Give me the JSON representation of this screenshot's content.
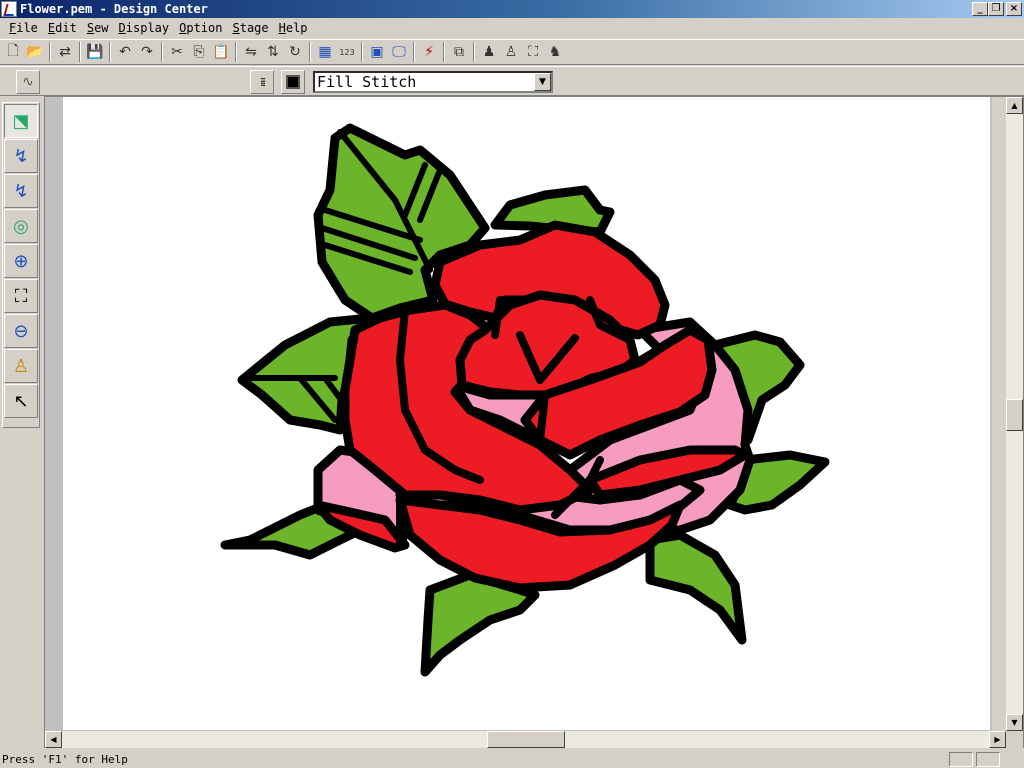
{
  "window": {
    "title": "Flower.pem - Design Center",
    "minimize": "_",
    "maximize": "❐",
    "close": "×"
  },
  "menu": [
    {
      "acc": "F",
      "rest": "ile"
    },
    {
      "acc": "E",
      "rest": "dit"
    },
    {
      "acc": "S",
      "rest": "ew"
    },
    {
      "acc": "D",
      "rest": "isplay"
    },
    {
      "acc": "O",
      "rest": "ption"
    },
    {
      "acc": "S",
      "rest": "tage"
    },
    {
      "acc": "H",
      "rest": "elp"
    }
  ],
  "toolbar": {
    "new": "🗋",
    "open": "📂",
    "import": "⇄",
    "save": "💾",
    "undo": "↶",
    "redo": "↷",
    "cut": "✂",
    "copy": "⎘",
    "paste": "📋",
    "mirror": "⇋",
    "flip": "⇅",
    "rotate": "↻",
    "grid": "▦",
    "numbers": "123",
    "preview": "▣",
    "monitor": "🖵",
    "sew": "⚡",
    "window": "⧉",
    "stage1": "♟",
    "stage2": "♙",
    "stage3": "⛶",
    "stage4": "♞"
  },
  "toolbar2": {
    "curve_icon": "∿",
    "stitch_icon": "⁞⁞⁞",
    "stitch_type": "Fill Stitch"
  },
  "palette": [
    "⬔",
    "↯",
    "↯",
    "◎",
    "⊕",
    "⛶",
    "⊖",
    "♙",
    "↖"
  ],
  "status": {
    "help_text": "Press 'F1' for Help"
  },
  "colors": {
    "rose_red": "#ed1c24",
    "rose_pink": "#f59cc0",
    "leaf_green": "#6cb52a",
    "outline": "#000000"
  }
}
